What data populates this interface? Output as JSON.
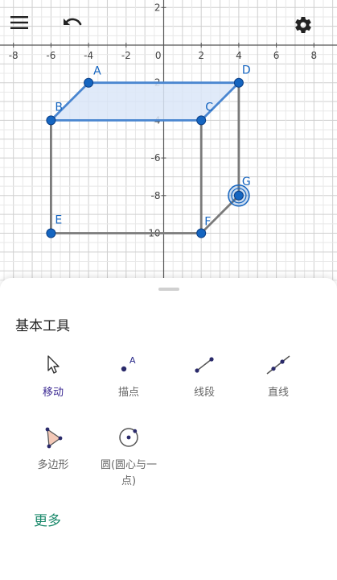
{
  "toolbar": {
    "menu_icon": "menu-icon",
    "undo_icon": "undo-icon",
    "settings_icon": "gear-icon"
  },
  "graph": {
    "x_ticks": [
      "-8",
      "-6",
      "-4",
      "-2",
      "0",
      "2",
      "4",
      "6",
      "8"
    ],
    "y_ticks": [
      "2",
      "-2",
      "-4",
      "-6",
      "-8",
      "-10"
    ],
    "points": [
      {
        "label": "A",
        "x": -4,
        "y": -2
      },
      {
        "label": "B",
        "x": -6,
        "y": -4
      },
      {
        "label": "C",
        "x": 2,
        "y": -4
      },
      {
        "label": "D",
        "x": 4,
        "y": -2
      },
      {
        "label": "E",
        "x": -6,
        "y": -10
      },
      {
        "label": "F",
        "x": 2,
        "y": -10
      },
      {
        "label": "G",
        "x": 4,
        "y": -8
      }
    ],
    "selected_point": "G",
    "colors": {
      "point": "#1565c0",
      "polygon_fill": "#dbe6f8",
      "polygon_stroke": "#4a86d0",
      "segment": "#7a7a7a",
      "grid_minor": "#e8e8e8",
      "grid_major": "#cfcfcf",
      "axis": "#555555"
    }
  },
  "panel": {
    "title": "基本工具",
    "tools": [
      {
        "label": "移动",
        "icon": "cursor-arrow-icon",
        "active": true
      },
      {
        "label": "描点",
        "icon": "point-icon",
        "active": false
      },
      {
        "label": "线段",
        "icon": "segment-icon",
        "active": false
      },
      {
        "label": "直线",
        "icon": "line-icon",
        "active": false
      },
      {
        "label": "多边形",
        "icon": "polygon-icon",
        "active": false
      },
      {
        "label_line1": "圆(圆心与一",
        "label_line2": "点)",
        "icon": "circle-center-point-icon",
        "active": false
      }
    ],
    "more_label": "更多"
  }
}
